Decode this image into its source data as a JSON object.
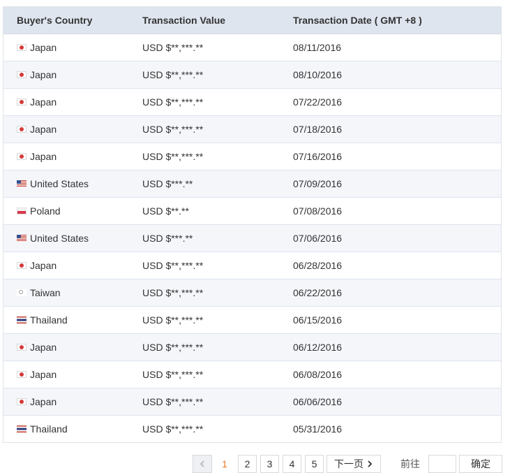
{
  "table": {
    "headers": {
      "country": "Buyer's Country",
      "value": "Transaction Value",
      "date": "Transaction Date ( GMT +8 )"
    },
    "rows": [
      {
        "flag": "jp",
        "country": "Japan",
        "value": "USD $**,***.**",
        "date": "08/11/2016"
      },
      {
        "flag": "jp",
        "country": "Japan",
        "value": "USD $**,***.**",
        "date": "08/10/2016"
      },
      {
        "flag": "jp",
        "country": "Japan",
        "value": "USD $**,***.**",
        "date": "07/22/2016"
      },
      {
        "flag": "jp",
        "country": "Japan",
        "value": "USD $**,***.**",
        "date": "07/18/2016"
      },
      {
        "flag": "jp",
        "country": "Japan",
        "value": "USD $**,***.**",
        "date": "07/16/2016"
      },
      {
        "flag": "us",
        "country": "United States",
        "value": "USD $***.**",
        "date": "07/09/2016"
      },
      {
        "flag": "pl",
        "country": "Poland",
        "value": "USD $**.**",
        "date": "07/08/2016"
      },
      {
        "flag": "us",
        "country": "United States",
        "value": "USD $***.**",
        "date": "07/06/2016"
      },
      {
        "flag": "jp",
        "country": "Japan",
        "value": "USD $**,***.**",
        "date": "06/28/2016"
      },
      {
        "flag": "tw",
        "country": "Taiwan",
        "value": "USD $**,***.**",
        "date": "06/22/2016"
      },
      {
        "flag": "th",
        "country": "Thailand",
        "value": "USD $**,***.**",
        "date": "06/15/2016"
      },
      {
        "flag": "jp",
        "country": "Japan",
        "value": "USD $**,***.**",
        "date": "06/12/2016"
      },
      {
        "flag": "jp",
        "country": "Japan",
        "value": "USD $**,***.**",
        "date": "06/08/2016"
      },
      {
        "flag": "jp",
        "country": "Japan",
        "value": "USD $**,***.**",
        "date": "06/06/2016"
      },
      {
        "flag": "th",
        "country": "Thailand",
        "value": "USD $**,***.**",
        "date": "05/31/2016"
      }
    ]
  },
  "pagination": {
    "prev_icon": "chevron-left-icon",
    "pages": [
      "1",
      "2",
      "3",
      "4",
      "5"
    ],
    "current_page": "1",
    "next_label": "下一页",
    "next_icon": "chevron-right-icon",
    "goto_label": "前往",
    "goto_value": "",
    "confirm_label": "确定"
  },
  "colors": {
    "header_bg": "#dfe5ef",
    "row_alt_bg": "#f4f6fa",
    "current_page": "#e87722"
  }
}
